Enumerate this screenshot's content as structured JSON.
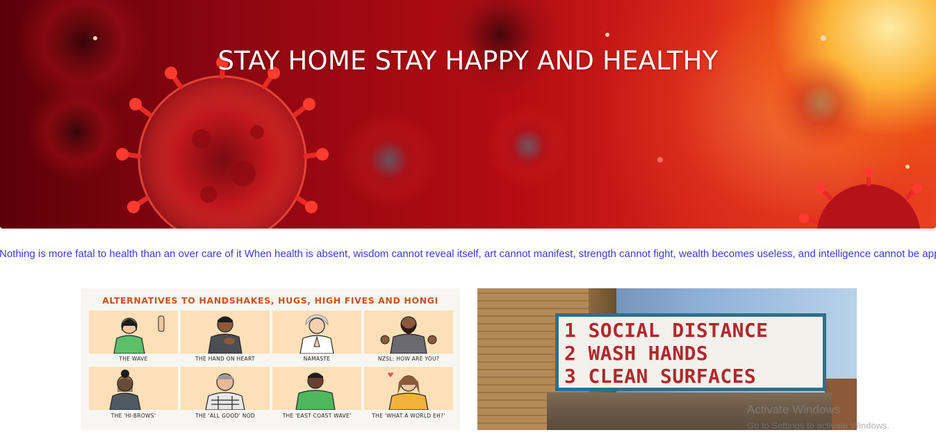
{
  "hero": {
    "title": "STAY HOME STAY HAPPY AND HEALTHY"
  },
  "quote": {
    "text": "Nothing is more fatal to health than an over care of it When health is absent, wisdom cannot reveal itself, art cannot manifest, strength cannot fight, wealth becomes useless, and intelligence cannot be applied."
  },
  "card_left": {
    "title": "ALTERNATIVES TO HANDSHAKES, HUGS, HIGH FIVES AND HONGI",
    "captions": [
      "THE WAVE",
      "THE HAND ON HEART",
      "NAMASTE",
      "NZSL: HOW ARE YOU?",
      "THE 'HI-BROWS'",
      "THE 'ALL GOOD' NOD",
      "THE 'EAST COAST WAVE'",
      "THE 'WHAT A WORLD EH?'"
    ]
  },
  "card_right": {
    "lines": [
      "1 SOCIAL DISTANCE",
      "2 WASH HANDS",
      "3 CLEAN SURFACES"
    ]
  },
  "watermark": {
    "line1": "Activate Windows",
    "line2": "Go to Settings to activate Windows."
  },
  "colors": {
    "quote_text": "#3b37e6",
    "card_title": "#c8531e",
    "marquee_text": "#b1282c"
  }
}
